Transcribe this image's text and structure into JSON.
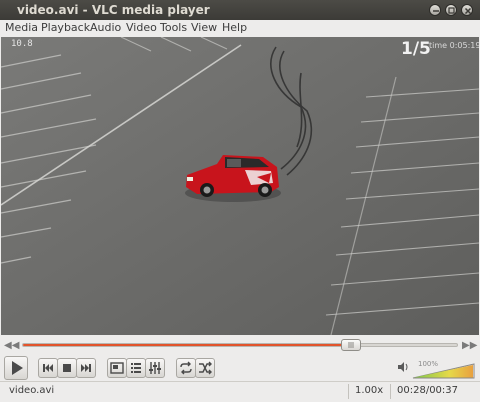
{
  "window": {
    "title": "video.avi - VLC media player"
  },
  "menu": [
    {
      "id": "media",
      "label": "Media"
    },
    {
      "id": "playback",
      "label": "Playback"
    },
    {
      "id": "audio",
      "label": "Audio"
    },
    {
      "id": "video",
      "label": "Video"
    },
    {
      "id": "tools",
      "label": "Tools"
    },
    {
      "id": "view",
      "label": "View"
    },
    {
      "id": "help",
      "label": "Help"
    }
  ],
  "video": {
    "osd_top_left": "10.8",
    "osd_lap": "1/5",
    "osd_time": "time 0:05:19"
  },
  "seek": {
    "position_fraction": 0.756
  },
  "controls": {
    "play": "play-icon",
    "buttons": [
      "previous-icon",
      "stop-icon",
      "next-icon",
      "fullscreen-icon",
      "playlist-icon",
      "equalizer-icon",
      "loop-icon",
      "shuffle-icon"
    ]
  },
  "volume": {
    "label": "100%",
    "level": 1.0
  },
  "status": {
    "filename": "video.avi",
    "speed": "1.00x",
    "time": "00:28/00:37"
  },
  "colors": {
    "seek_fill": "#e2542c",
    "titlebar": "#3c3b37",
    "car": "#c8141c"
  }
}
